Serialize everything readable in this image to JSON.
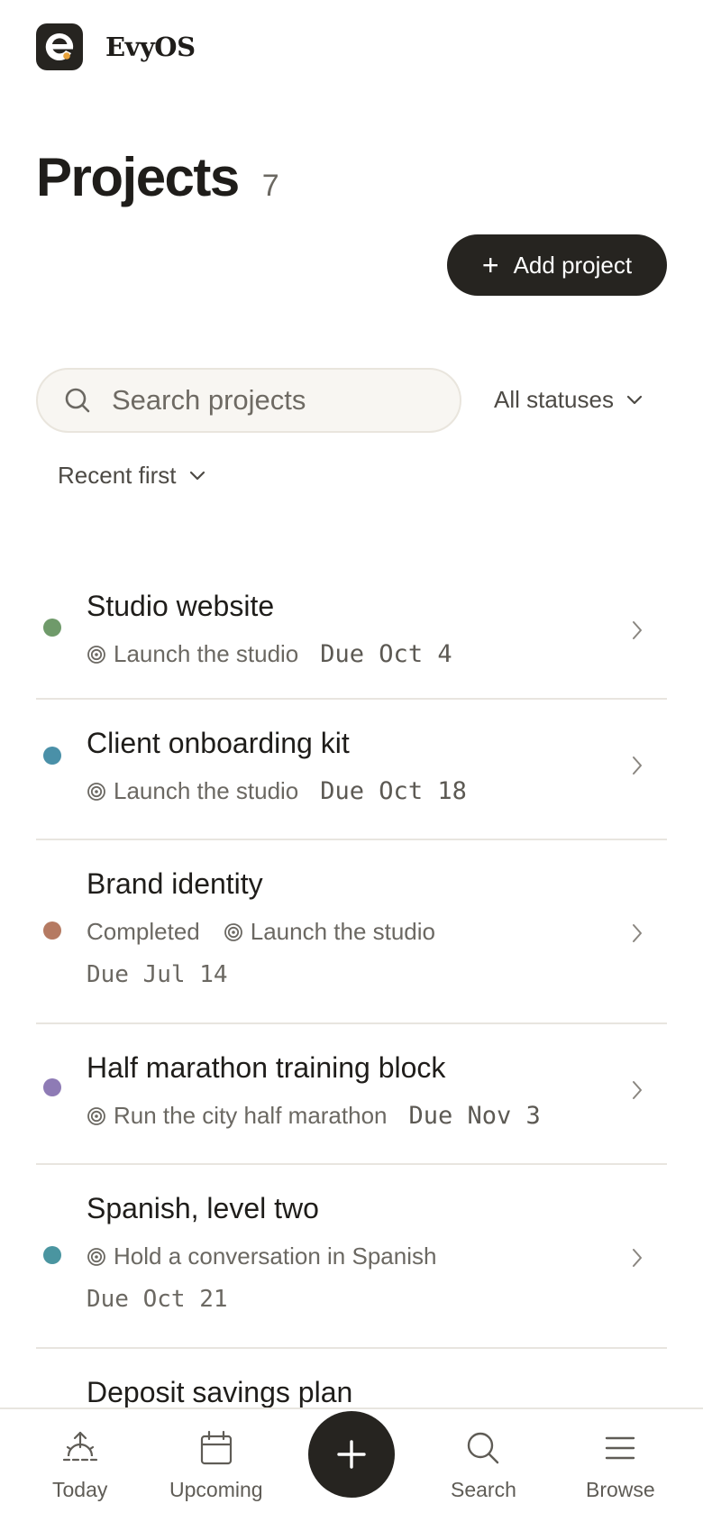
{
  "app": {
    "brand": "EvyOS"
  },
  "page": {
    "title": "Projects",
    "count": "7"
  },
  "actions": {
    "add_project": "Add project"
  },
  "search": {
    "placeholder": "Search projects"
  },
  "filters": {
    "status": "All statuses",
    "sort": "Recent first"
  },
  "projects": [
    {
      "name": "Studio website",
      "status": "",
      "goal": "Launch the studio",
      "due": "Due Oct 4",
      "color": "#6f9a6a"
    },
    {
      "name": "Client onboarding kit",
      "status": "",
      "goal": "Launch the studio",
      "due": "Due Oct 18",
      "color": "#4a90a8"
    },
    {
      "name": "Brand identity",
      "status": "Completed",
      "goal": "Launch the studio",
      "due": "Due Jul 14",
      "color": "#b57a62"
    },
    {
      "name": "Half marathon training block",
      "status": "",
      "goal": "Run the city half marathon",
      "due": "Due Nov 3",
      "color": "#8e7bb5"
    },
    {
      "name": "Spanish, level two",
      "status": "",
      "goal": "Hold a conversation in Spanish",
      "due": "Due Oct 21",
      "color": "#4a95a0"
    },
    {
      "name": "Deposit savings plan",
      "status": "",
      "goal": "",
      "due": "",
      "color": "#c0a060"
    }
  ],
  "nav": {
    "today": "Today",
    "upcoming": "Upcoming",
    "search": "Search",
    "browse": "Browse"
  },
  "icons": {
    "goal": "target-icon",
    "row_arrow": "chevron-right-icon",
    "fab": "plus-icon"
  }
}
